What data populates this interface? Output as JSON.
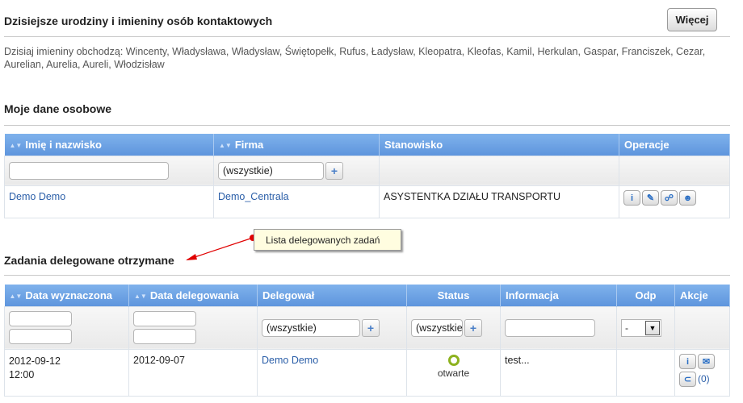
{
  "birthdays": {
    "title": "Dzisiejsze urodziny i imieniny osób kontaktowych",
    "more_button": "Więcej",
    "names_text": "Dzisiaj imieniny obchodzą: Wincenty, Władysława, Władysław, Świętopełk, Rufus, Ładysław, Kleopatra, Kleofas, Kamil, Herkulan, Gaspar, Franciszek, Cezar, Aurelian, Aurelia, Aureli, Włodzisław"
  },
  "personal": {
    "title": "Moje dane osobowe",
    "headers": [
      "Imię i nazwisko",
      "Firma",
      "Stanowisko",
      "Operacje"
    ],
    "filter_company": "(wszystkie)",
    "row": {
      "name": "Demo Demo",
      "company": "Demo_Centrala",
      "position": "ASYSTENTKA DZIAŁU TRANSPORTU"
    }
  },
  "callout": {
    "text": "Lista delegowanych zadań"
  },
  "delegated": {
    "title": "Zadania delegowane otrzymane",
    "headers": [
      "Data wyznaczona",
      "Data delegowania",
      "Delegował",
      "Status",
      "Informacja",
      "Odp",
      "Akcje"
    ],
    "filter_delegated_by": "(wszystkie)",
    "filter_status": "(wszystkie)",
    "filter_odp": "-",
    "row": {
      "due_date": "2012-09-12",
      "due_time": "12:00",
      "delegated_date": "2012-09-07",
      "delegated_by": "Demo Demo",
      "status": "otwarte",
      "info": "test...",
      "attachments": "(0)"
    }
  },
  "colors": {
    "header_blue": "#6aa0e4",
    "link": "#2a5ea8",
    "status_open": "#8db21e",
    "callout_bg": "#fffde0",
    "arrow": "#e00000"
  }
}
